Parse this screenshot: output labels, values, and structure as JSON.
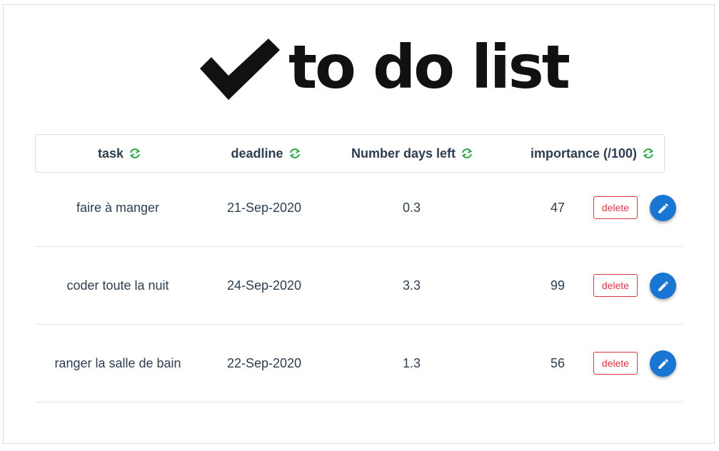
{
  "app": {
    "logo_text": "to do list",
    "logo_icon": "checkmark-icon",
    "accent_color": "#1976d2",
    "sort_icon_color": "#28a745",
    "delete_color": "#dc3545"
  },
  "table": {
    "columns": [
      {
        "label": "task",
        "icon": "sort-refresh-icon"
      },
      {
        "label": "deadline",
        "icon": "sort-refresh-icon"
      },
      {
        "label": "Number days left",
        "icon": "sort-refresh-icon"
      },
      {
        "label": "importance (/100)",
        "icon": "sort-refresh-icon"
      }
    ],
    "rows": [
      {
        "task": "faire à manger",
        "deadline": "21-Sep-2020",
        "days_left": "0.3",
        "importance": "47",
        "delete_label": "delete",
        "edit_icon": "pencil-icon"
      },
      {
        "task": "coder toute la nuit",
        "deadline": "24-Sep-2020",
        "days_left": "3.3",
        "importance": "99",
        "delete_label": "delete",
        "edit_icon": "pencil-icon"
      },
      {
        "task": "ranger la salle de bain",
        "deadline": "22-Sep-2020",
        "days_left": "1.3",
        "importance": "56",
        "delete_label": "delete",
        "edit_icon": "pencil-icon"
      }
    ]
  }
}
